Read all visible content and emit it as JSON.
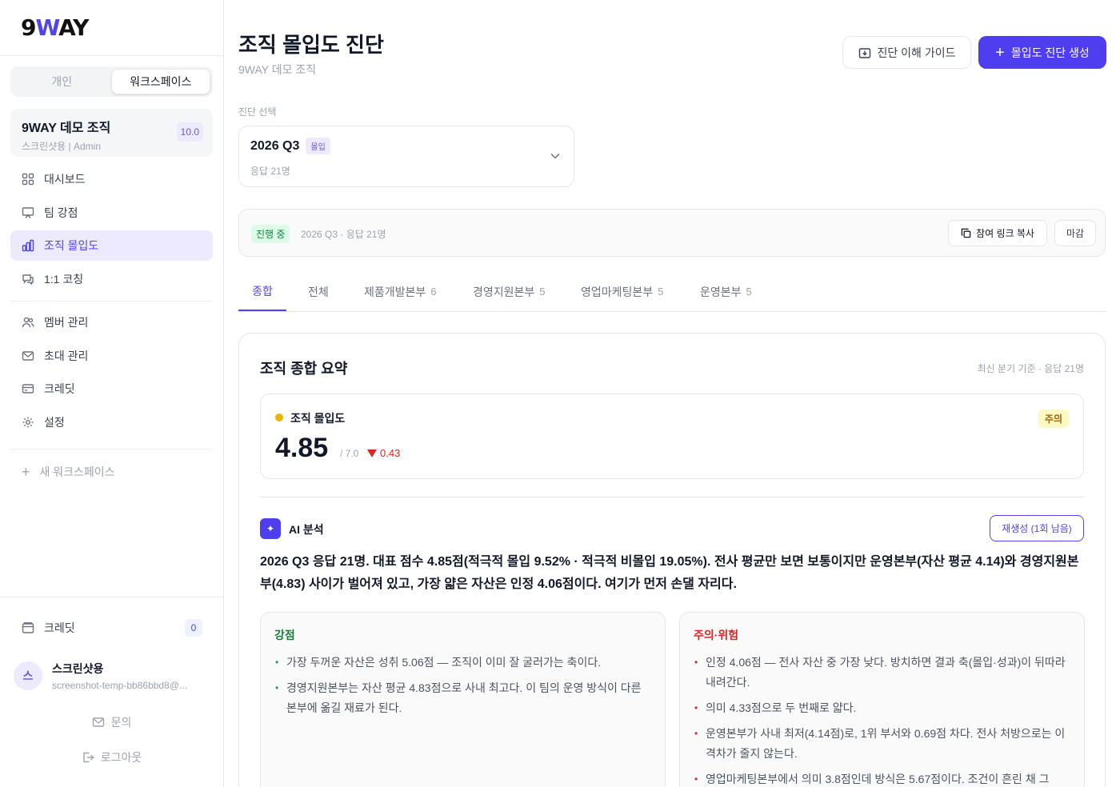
{
  "brand": {
    "logo": "9WAY"
  },
  "sidebar": {
    "segment": [
      "개인",
      "워크스페이스"
    ],
    "org": {
      "name": "9WAY 데모 조직",
      "sub": "스크린샷용 | Admin",
      "badge": "10.0"
    },
    "nav_main": [
      {
        "label": "대시보드",
        "icon": "grid-icon"
      },
      {
        "label": "팀 강점",
        "icon": "presentation-icon"
      },
      {
        "label": "조직 몰입도",
        "icon": "bar-chart-icon",
        "active": true
      },
      {
        "label": "1:1 코칭",
        "icon": "chat-icon"
      }
    ],
    "nav_admin": [
      {
        "label": "멤버 관리",
        "icon": "users-icon"
      },
      {
        "label": "초대 관리",
        "icon": "mail-icon"
      },
      {
        "label": "크레딧",
        "icon": "card-icon"
      },
      {
        "label": "설정",
        "icon": "gear-icon"
      }
    ],
    "new_workspace": "새 워크스페이스",
    "credit": {
      "label": "크레딧",
      "count": "0"
    },
    "user": {
      "initial": "스",
      "name": "스크린샷용",
      "email": "screenshot-temp-bb86bbd8@..."
    },
    "inquiry": "문의",
    "logout": "로그아웃"
  },
  "header": {
    "title": "조직 몰입도 진단",
    "subtitle": "9WAY 데모 조직",
    "guide_button": "진단 이해 가이드",
    "create_button": "몰입도 진단 생성"
  },
  "selector": {
    "label": "진단 선택",
    "title": "2026 Q3",
    "chip": "몰입",
    "sub": "응답 21명"
  },
  "status": {
    "chip": "진행 중",
    "text": "2026 Q3 · 응답 21명",
    "copy_button": "참여 링크 복사",
    "close_button": "마감"
  },
  "tabs": [
    {
      "label": "종합",
      "count": ""
    },
    {
      "label": "전체",
      "count": ""
    },
    {
      "label": "제품개발본부",
      "count": "6"
    },
    {
      "label": "경영지원본부",
      "count": "5"
    },
    {
      "label": "영업마케팅본부",
      "count": "5"
    },
    {
      "label": "운영본부",
      "count": "5"
    }
  ],
  "summary": {
    "title": "조직 종합 요약",
    "meta": "최신 분기 기준 · 응답 21명",
    "metric": {
      "label": "조직 몰입도",
      "badge": "주의",
      "value": "4.85",
      "max": "/ 7.0",
      "delta": "0.43",
      "status_color": "#eab308"
    },
    "ai": {
      "icon_text": "✦",
      "title": "AI 분석",
      "regen_button": "재생성 (1회 남음)",
      "text": "2026 Q3 응답 21명. 대표 점수 4.85점(적극적 몰입 9.52% · 적극적 비몰입 19.05%). 전사 평균만 보면 보통이지만 운영본부(자산 평균 4.14)와 경영지원본부(4.83) 사이가 벌어져 있고, 가장 얇은 자산은 인정 4.06점이다. 여기가 먼저 손댈 자리다."
    },
    "strengths": {
      "title": "강점",
      "items": [
        "가장 두꺼운 자산은 성취 5.06점 — 조직이 이미 잘 굴러가는 축이다.",
        "경영지원본부는 자산 평균 4.83점으로 사내 최고다. 이 팀의 운영 방식이 다른 본부에 옮길 재료가 된다."
      ]
    },
    "risks": {
      "title": "주의·위험",
      "items": [
        "인정 4.06점 — 전사 자산 중 가장 낮다. 방치하면 결과 축(몰입·성과)이 뒤따라 내려간다.",
        "의미 4.33점으로 두 번째로 얇다.",
        "운영본부가 사내 최저(4.14점)로, 1위 부서와 0.69점 차다. 전사 처방으로는 이 격차가 줄지 않는다.",
        "영업마케팅본부에서 의미 3.8점인데 방식은 5.67점이다. 조건이 흔린 채 그"
      ]
    }
  }
}
